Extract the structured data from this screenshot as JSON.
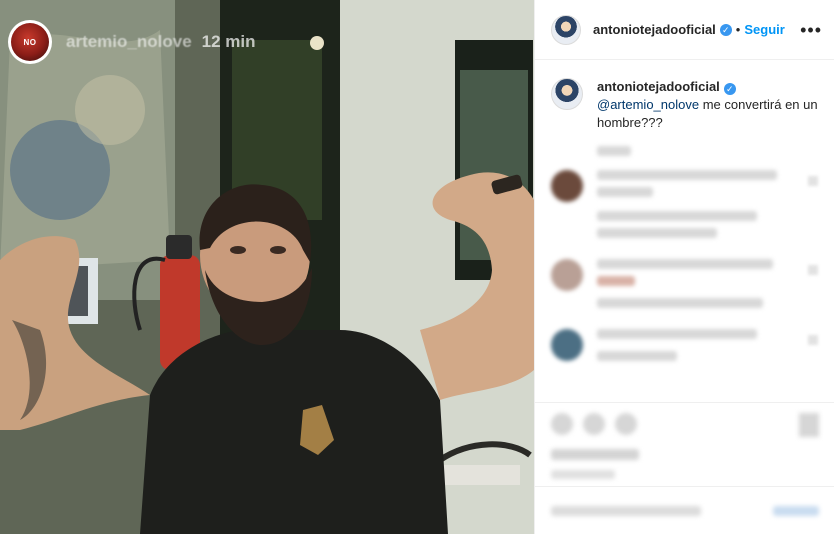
{
  "story": {
    "avatar_text": "NO",
    "username": "artemio_nolove",
    "time": "12 min"
  },
  "header": {
    "username": "antoniotejadooficial",
    "follow_label": "Seguir",
    "more_label": "•••"
  },
  "caption": {
    "username": "antoniotejadooficial",
    "mention": "@artemio_nolove",
    "text": " me convertirá en un hombre???"
  },
  "colors": {
    "accent": "#0095f6",
    "verified": "#3897f0",
    "mention": "#00376b"
  },
  "icons": [
    "verified-badge-icon",
    "more-options-icon",
    "like-icon",
    "comment-icon",
    "share-icon",
    "save-icon"
  ]
}
